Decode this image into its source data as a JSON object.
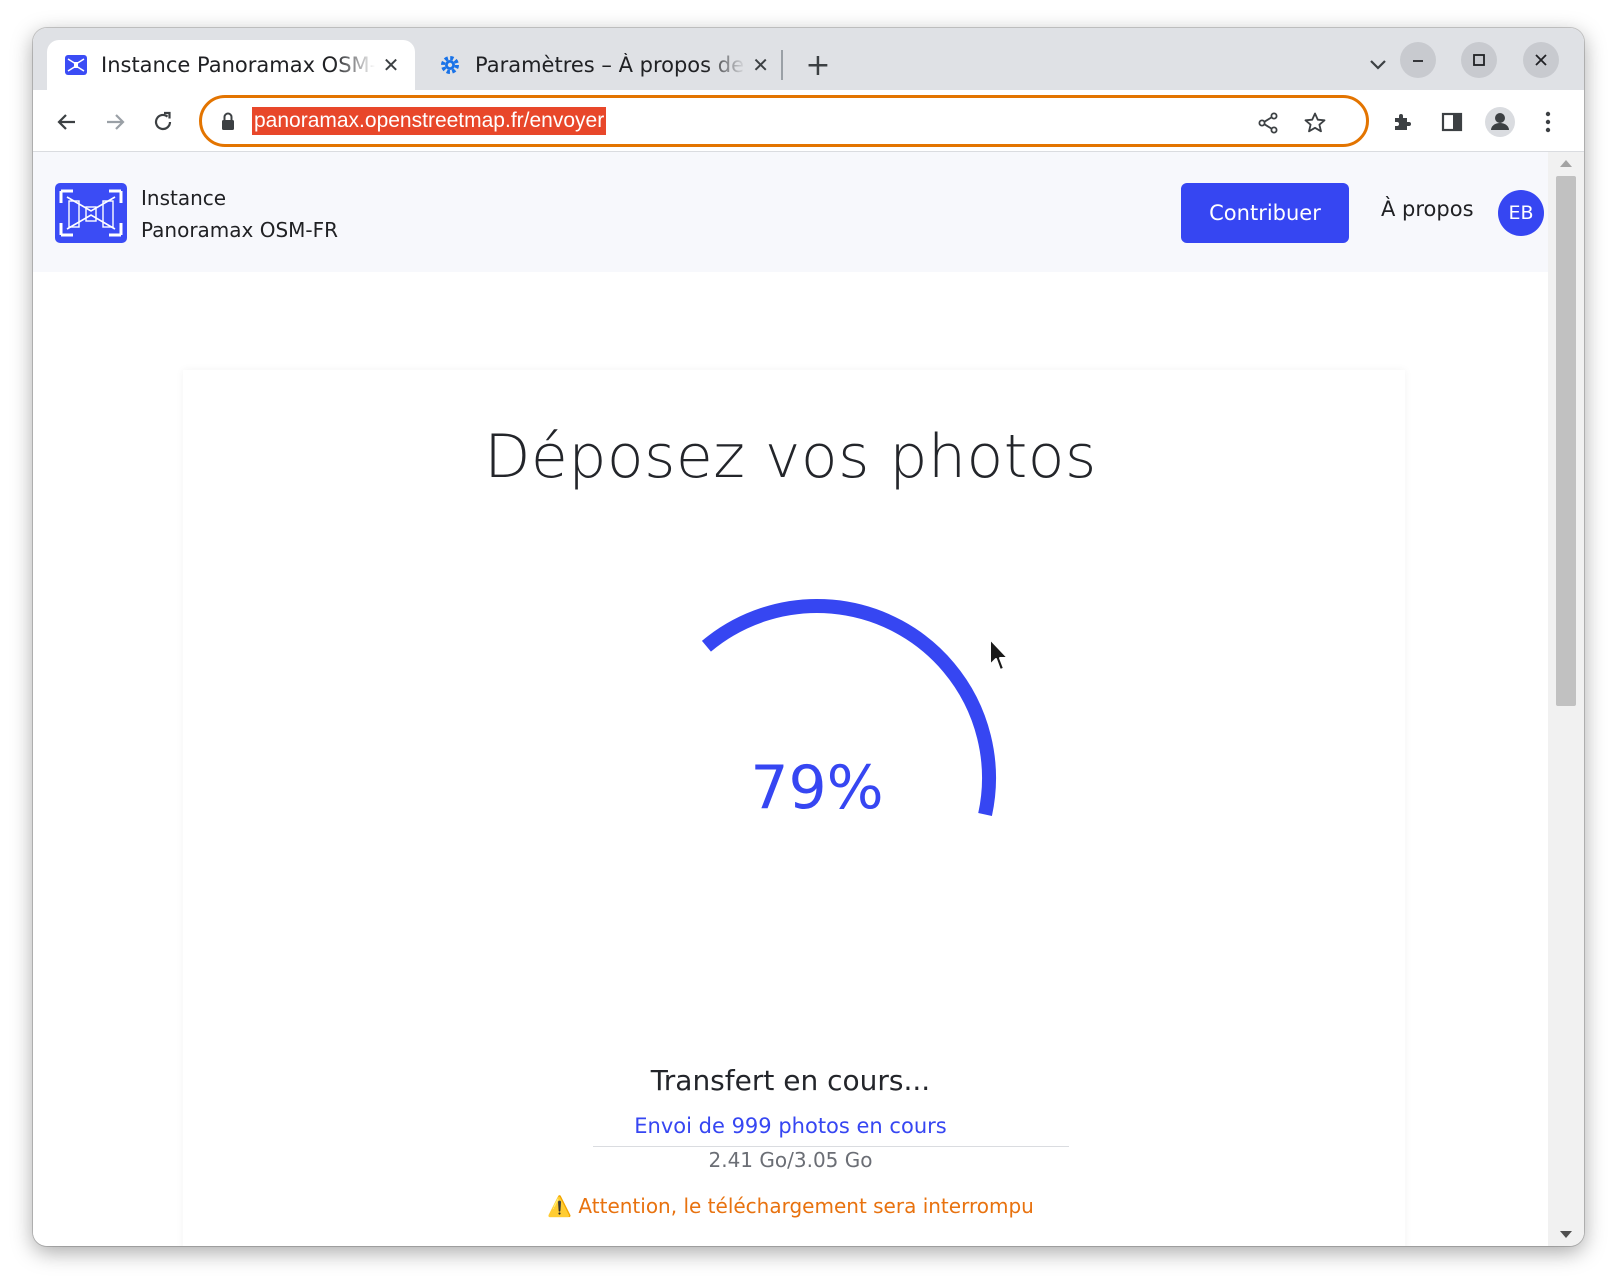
{
  "browser": {
    "tabs": [
      {
        "title": "Instance Panoramax OSM-FR",
        "active": true,
        "favicon": "panoramax-logo-icon"
      },
      {
        "title": "Paramètres – À propos de Chrome",
        "active": false,
        "favicon": "gear-icon"
      }
    ],
    "new_tab": "+",
    "tab_close": "✕",
    "address_bar": {
      "url": "panoramax.openstreetmap.fr/envoyer"
    },
    "accent_color": "#e37400",
    "url_highlight_color": "#e8472a"
  },
  "site": {
    "brand_line1": "Instance",
    "brand_line2": "Panoramax OSM-FR",
    "nav": {
      "contribute": "Contribuer",
      "about": "À propos",
      "avatar_initials": "EB"
    },
    "brand_color": "#3646f2"
  },
  "upload": {
    "title": "Déposez vos photos",
    "progress_percent": 79,
    "progress_label": "79%",
    "status": "Transfert en cours...",
    "sending_text": "Envoi de 999 photos en cours",
    "size_text": "2.41 Go/3.05 Go",
    "warning": "⚠️ Attention, le téléchargement sera interrompu"
  }
}
